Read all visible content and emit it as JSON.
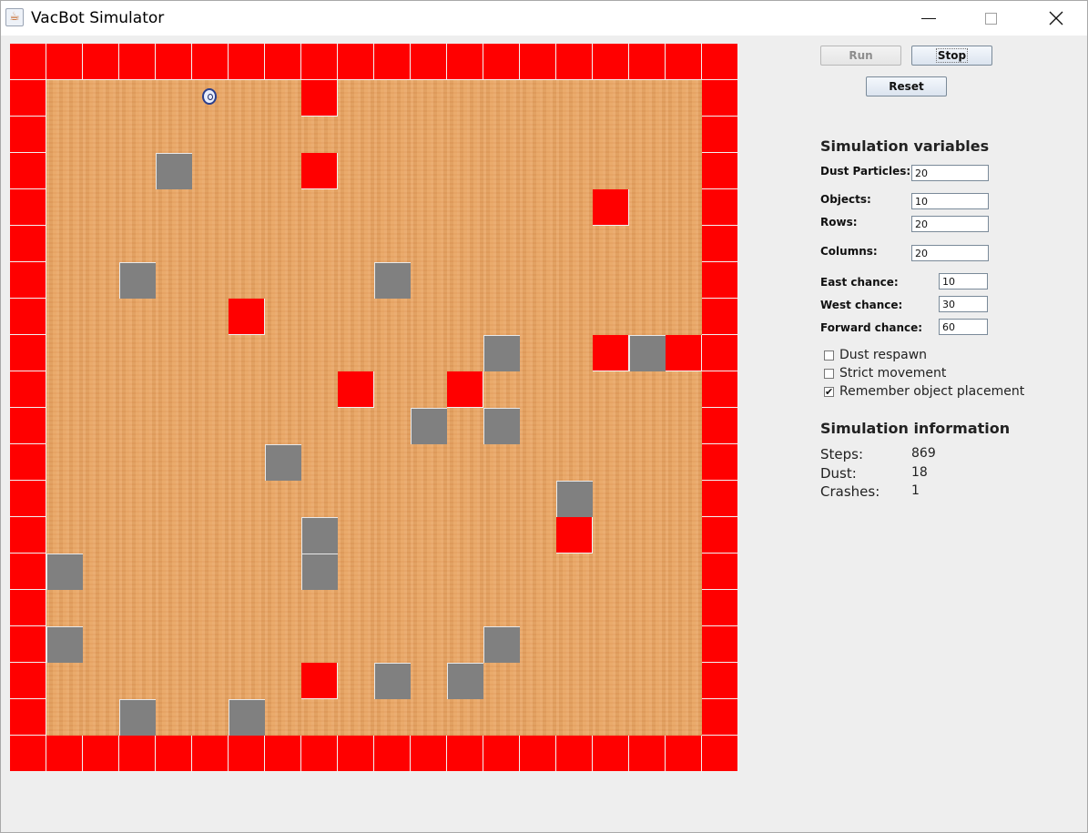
{
  "window": {
    "title": "VacBot Simulator",
    "icon": "java-cup-icon",
    "controls": [
      "minimize-icon",
      "maximize-icon",
      "close-icon"
    ]
  },
  "grid": {
    "rows": 20,
    "columns": 20,
    "tile_colors": {
      "wall": "#ff0000",
      "obstacle": "#808080",
      "floor": "#e8a361"
    },
    "wall_cells": [
      [
        1,
        8
      ],
      [
        3,
        8
      ],
      [
        4,
        16
      ],
      [
        7,
        6
      ],
      [
        8,
        16
      ],
      [
        8,
        18
      ],
      [
        9,
        9
      ],
      [
        9,
        12
      ],
      [
        13,
        15
      ],
      [
        17,
        8
      ]
    ],
    "obstacle_cells": [
      [
        3,
        4
      ],
      [
        6,
        3
      ],
      [
        6,
        10
      ],
      [
        8,
        13
      ],
      [
        8,
        17
      ],
      [
        10,
        11
      ],
      [
        10,
        13
      ],
      [
        11,
        7
      ],
      [
        12,
        15
      ],
      [
        13,
        8
      ],
      [
        14,
        1
      ],
      [
        14,
        8
      ],
      [
        16,
        1
      ],
      [
        16,
        13
      ],
      [
        17,
        10
      ],
      [
        17,
        12
      ],
      [
        18,
        3
      ],
      [
        18,
        6
      ]
    ],
    "robot_cell": [
      1,
      5
    ]
  },
  "controls": {
    "run": "Run",
    "stop": "Stop",
    "reset": "Reset"
  },
  "variables": {
    "title": "Simulation variables",
    "dust_particles": {
      "label": "Dust Particles:",
      "value": "20"
    },
    "objects": {
      "label": "Objects:",
      "value": "10"
    },
    "rows": {
      "label": "Rows:",
      "value": "20"
    },
    "columns": {
      "label": "Columns:",
      "value": "20"
    },
    "east_chance": {
      "label": "East chance:",
      "value": "10"
    },
    "west_chance": {
      "label": "West chance:",
      "value": "30"
    },
    "forward_chance": {
      "label": "Forward chance:",
      "value": "60"
    }
  },
  "options": {
    "dust_respawn": {
      "label": "Dust respawn",
      "checked": false
    },
    "strict_movement": {
      "label": "Strict movement",
      "checked": false
    },
    "remember_placement": {
      "label": "Remember object placement",
      "checked": true
    }
  },
  "info": {
    "title": "Simulation information",
    "steps": {
      "label": "Steps:",
      "value": "869"
    },
    "dust": {
      "label": "Dust:",
      "value": "18"
    },
    "crashes": {
      "label": "Crashes:",
      "value": "1"
    }
  }
}
